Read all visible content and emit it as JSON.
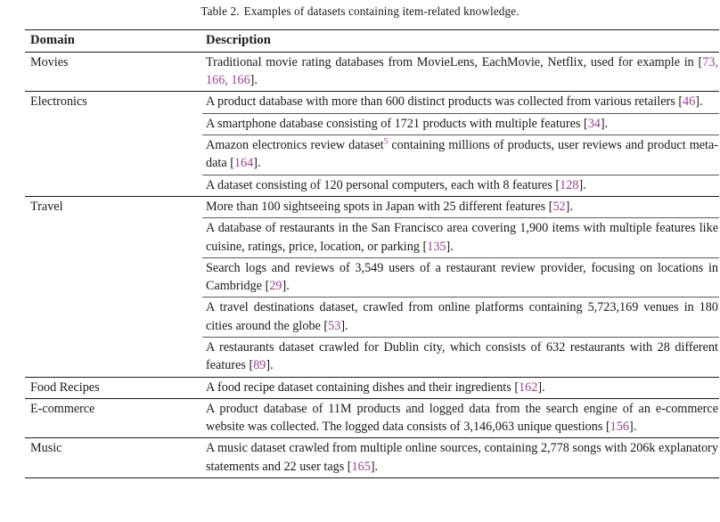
{
  "caption": {
    "label": "Table 2.",
    "text": "Examples of datasets containing item-related knowledge."
  },
  "table": {
    "columns": [
      "Domain",
      "Description"
    ],
    "rows": [
      {
        "domain": "Movies",
        "entries": [
          {
            "text": "Traditional movie rating databases from MovieLens, EachMovie, Netflix, used for example in [73, 166, 166].",
            "citations": [
              "73",
              "166",
              "166"
            ]
          }
        ]
      },
      {
        "domain": "Electronics",
        "entries": [
          {
            "text": "A product database with more than 600 distinct products was collected from various retailers [46].",
            "citations": [
              "46"
            ]
          },
          {
            "text": "A smartphone database consisting of 1721 products with multiple features [34].",
            "citations": [
              "34"
            ]
          },
          {
            "text": "Amazon electronics review dataset5 containing millions of products, user reviews and product meta-data [164].",
            "footnote": "5",
            "citations": [
              "164"
            ]
          },
          {
            "text": "A dataset consisting of 120 personal computers, each with 8 features [128].",
            "citations": [
              "128"
            ]
          }
        ]
      },
      {
        "domain": "Travel",
        "entries": [
          {
            "text": "More than 100 sightseeing spots in Japan with 25 different features [52].",
            "citations": [
              "52"
            ]
          },
          {
            "text": "A database of restaurants in the San Francisco area covering 1,900 items with multiple features like cuisine, ratings, price, location, or parking [135].",
            "citations": [
              "135"
            ]
          },
          {
            "text": "Search logs and reviews of 3,549 users of a restaurant review provider, focusing on locations in Cambridge [29].",
            "citations": [
              "29"
            ]
          },
          {
            "text": "A travel destinations dataset, crawled from online platforms containing 5,723,169 venues in 180 cities around the globe [53].",
            "citations": [
              "53"
            ]
          },
          {
            "text": "A restaurants dataset crawled for Dublin city, which consists of 632 restaurants with 28 different features [89].",
            "citations": [
              "89"
            ]
          }
        ]
      },
      {
        "domain": "Food Recipes",
        "entries": [
          {
            "text": "A food recipe dataset containing dishes and their ingredients [162].",
            "citations": [
              "162"
            ]
          }
        ]
      },
      {
        "domain": "E-commerce",
        "entries": [
          {
            "text": "A product database of 11M products and logged data from the search engine of an e-commerce website was collected. The logged data consists of 3,146,063 unique questions [156].",
            "citations": [
              "156"
            ]
          }
        ]
      },
      {
        "domain": "Music",
        "entries": [
          {
            "text": "A music dataset crawled from multiple online sources, containing 2,778 songs with 206k explanatory statements and 22 user tags [165].",
            "citations": [
              "165"
            ]
          }
        ]
      }
    ]
  },
  "colors": {
    "citation": "#9c3f93",
    "rule": "#1a1a1a",
    "text": "#1a1a1a"
  }
}
